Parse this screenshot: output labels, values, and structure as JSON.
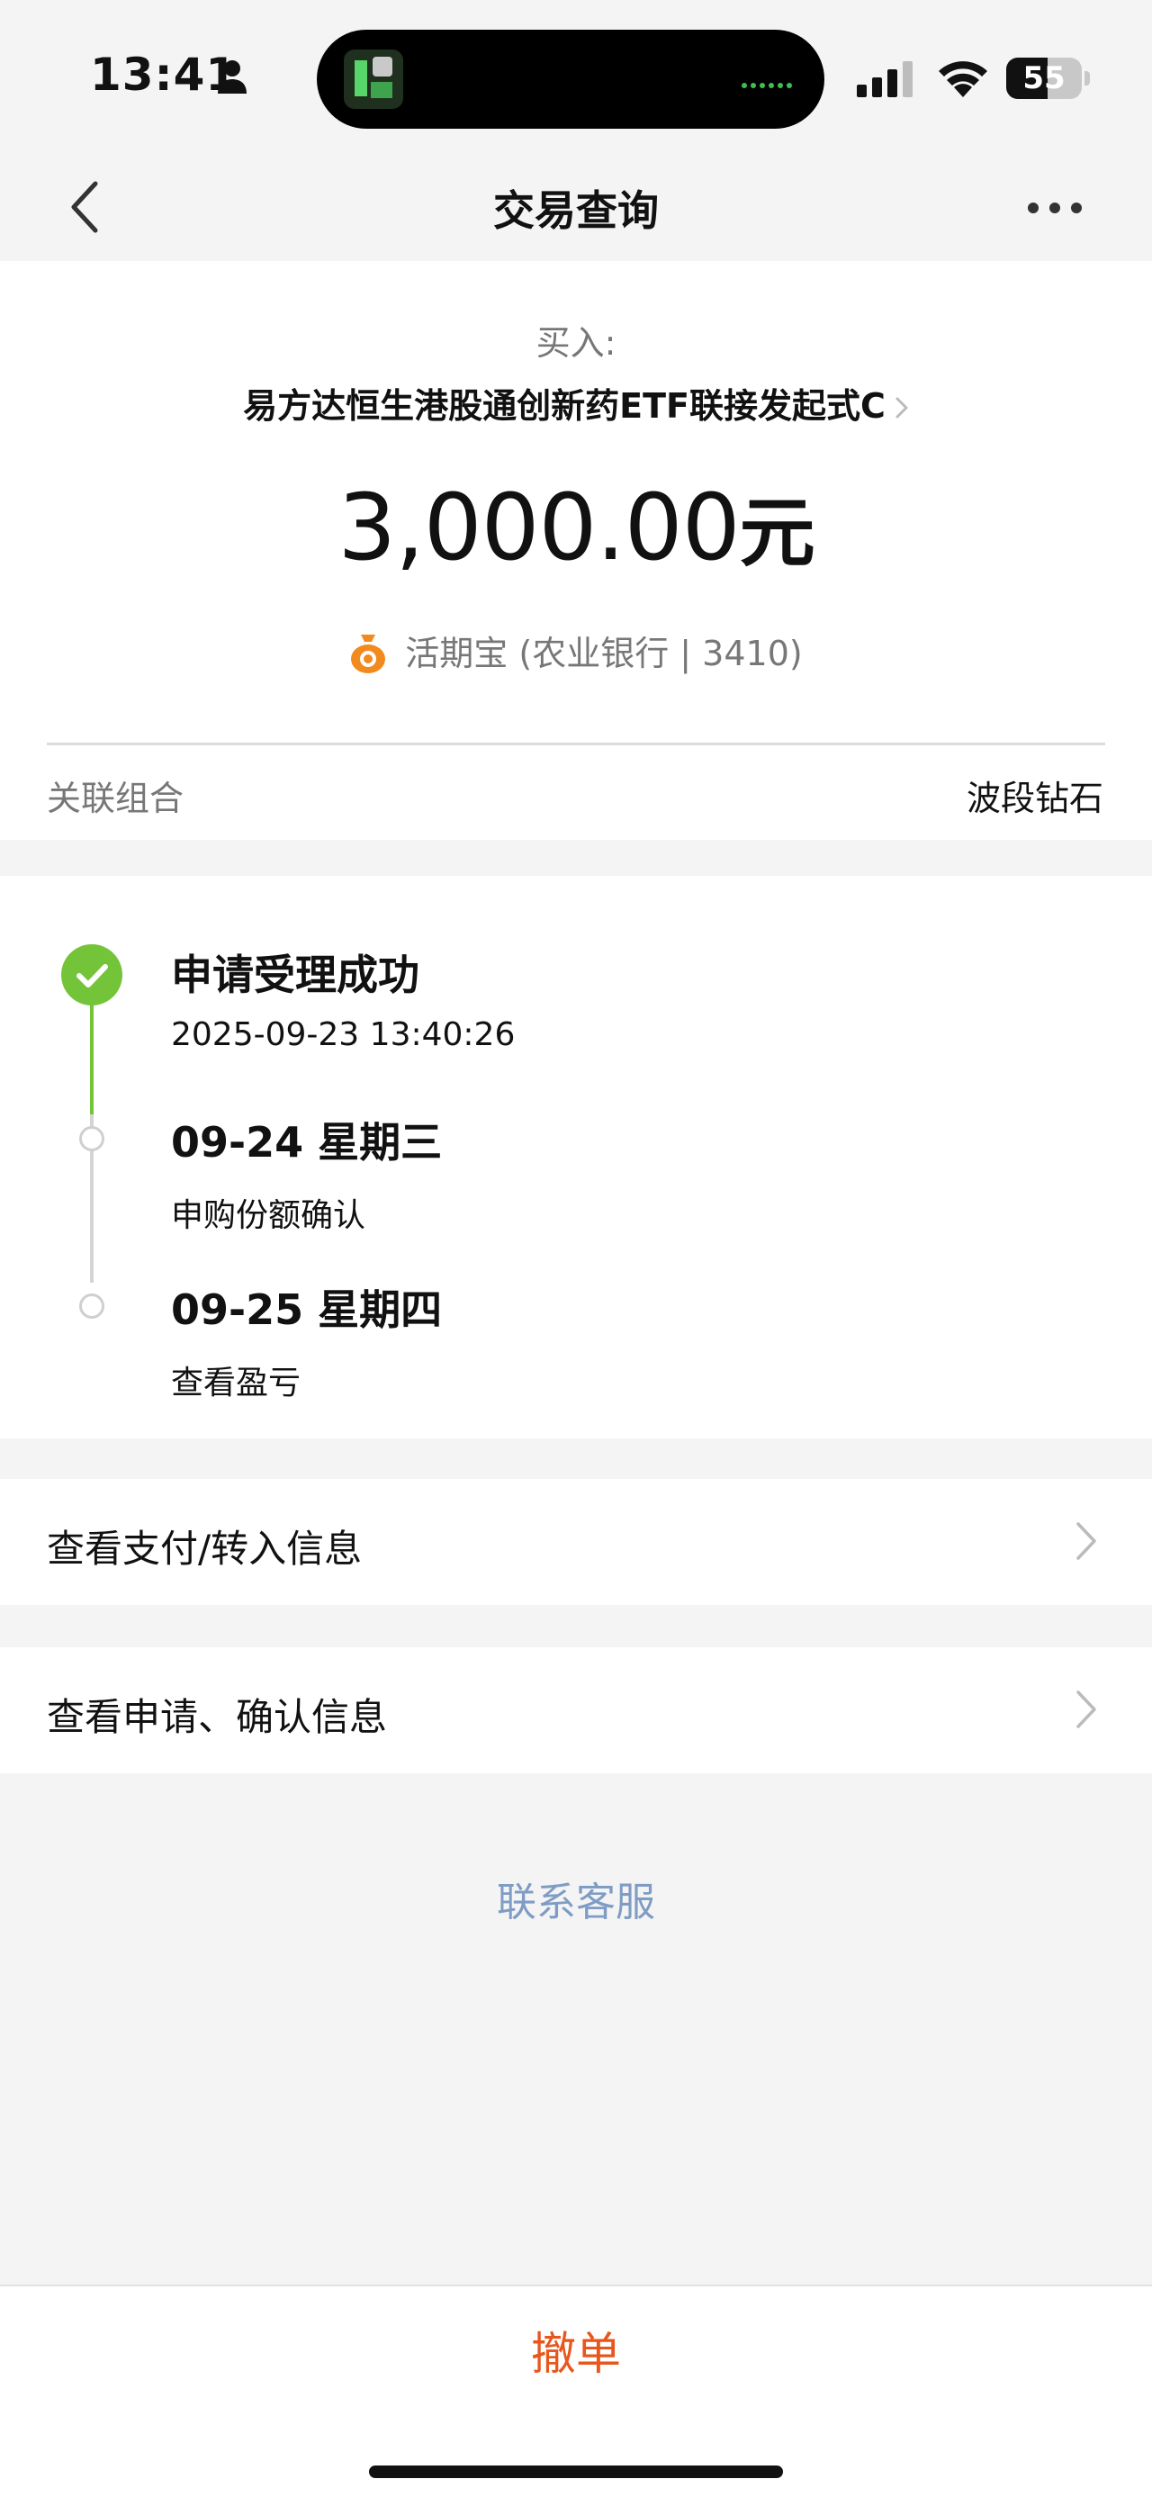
{
  "status_bar": {
    "time": "13:41",
    "battery": "55",
    "battery_level_percent": 55,
    "icons": [
      "person-icon",
      "signal-icon",
      "wifi-icon",
      "battery-icon"
    ]
  },
  "nav": {
    "title": "交易查询",
    "back_icon": "chevron-left-icon",
    "more_icon": "more-dots-icon"
  },
  "summary": {
    "buy_label": "买入:",
    "fund_name": "易方达恒生港股通创新药ETF联接发起式C",
    "amount_number": "3,000.00",
    "amount_unit": "元",
    "payment_method": "活期宝 (农业银行 | 3410)",
    "combo_label": "关联组合",
    "combo_value": "波段钻石"
  },
  "timeline": [
    {
      "title": "申请受理成功",
      "subtitle": "2025-09-23 13:40:26",
      "status": "done"
    },
    {
      "title": "09-24 星期三",
      "subtitle": "申购份额确认",
      "status": "pending"
    },
    {
      "title": "09-25 星期四",
      "subtitle": "查看盈亏",
      "status": "pending"
    }
  ],
  "links": [
    {
      "label": "查看支付/转入信息"
    },
    {
      "label": "查看申请、确认信息"
    }
  ],
  "contact_label": "联系客服",
  "cancel_label": "撤单",
  "colors": {
    "accent_green": "#74c43a",
    "cancel_orange": "#e8561c",
    "link_blue": "#7f9cc5",
    "coin_orange": "#f28a1e"
  }
}
